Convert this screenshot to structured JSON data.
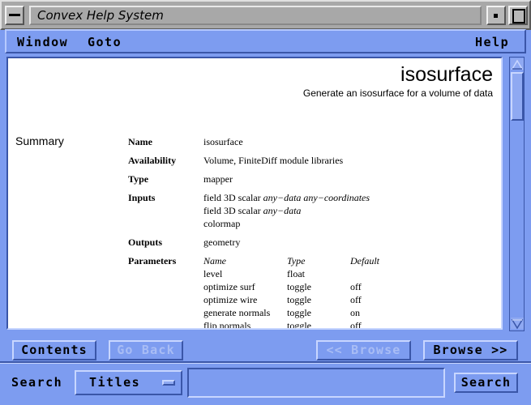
{
  "window": {
    "title": "Convex Help System"
  },
  "menubar": {
    "window": "Window",
    "goto": "Goto",
    "help": "Help"
  },
  "doc": {
    "title": "isosurface",
    "subtitle": "Generate an isosurface for a volume of data",
    "section": "Summary",
    "fields": {
      "name_label": "Name",
      "name": "isosurface",
      "availability_label": "Availability",
      "availability": "Volume, FiniteDiff module libraries",
      "type_label": "Type",
      "type": "mapper",
      "inputs_label": "Inputs",
      "input1_prefix": "field 3D scalar",
      "input1_italic": "any−data any−coordinates",
      "input2_prefix": "field 3D scalar",
      "input2_italic": "any−data",
      "input3": "colormap",
      "outputs_label": "Outputs",
      "outputs": "geometry",
      "parameters_label": "Parameters"
    },
    "param_headers": [
      "Name",
      "Type",
      "Default"
    ],
    "params": [
      [
        "level",
        "float",
        ""
      ],
      [
        "optimize surf",
        "toggle",
        "off"
      ],
      [
        "optimize wire",
        "toggle",
        "off"
      ],
      [
        "generate normals",
        "toggle",
        "on"
      ],
      [
        "flip normals",
        "toggle",
        "off"
      ]
    ]
  },
  "buttons": {
    "contents": "Contents",
    "go_back": "Go Back",
    "browse_prev": "<< Browse",
    "browse_next": "Browse >>"
  },
  "search": {
    "label": "Search",
    "mode": "Titles",
    "query": "",
    "button": "Search"
  }
}
